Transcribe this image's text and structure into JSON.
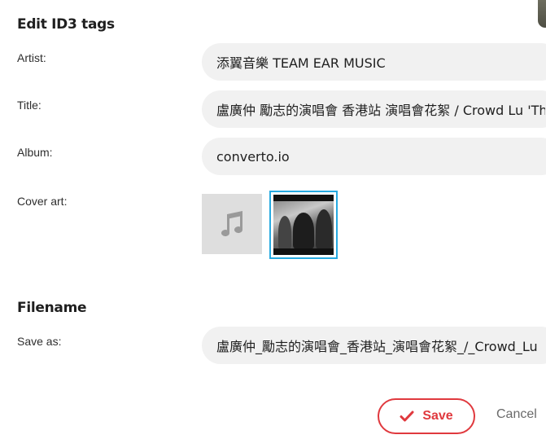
{
  "id3": {
    "title": "Edit ID3 tags",
    "artist_label": "Artist:",
    "artist_value": "添翼音樂 TEAM EAR MUSIC",
    "title_label": "Title:",
    "title_value": "盧廣仲 勵志的演唱會 香港站 演唱會花絮 / Crowd Lu 'The Show of Encouragement' Hong Kong",
    "album_label": "Album:",
    "album_value": "converto.io",
    "cover_label": "Cover art:"
  },
  "filename": {
    "title": "Filename",
    "save_as_label": "Save as:",
    "save_as_value": "盧廣仲_勵志的演唱會_香港站_演唱會花絮_/_Crowd_Lu"
  },
  "actions": {
    "save_label": "Save",
    "cancel_label": "Cancel"
  },
  "icons": {
    "default_cover": "music-note-icon",
    "save": "checkmark-icon"
  },
  "colors": {
    "accent": "#e0393e",
    "selected_border": "#27aae1",
    "input_bg": "#f1f1f1"
  }
}
